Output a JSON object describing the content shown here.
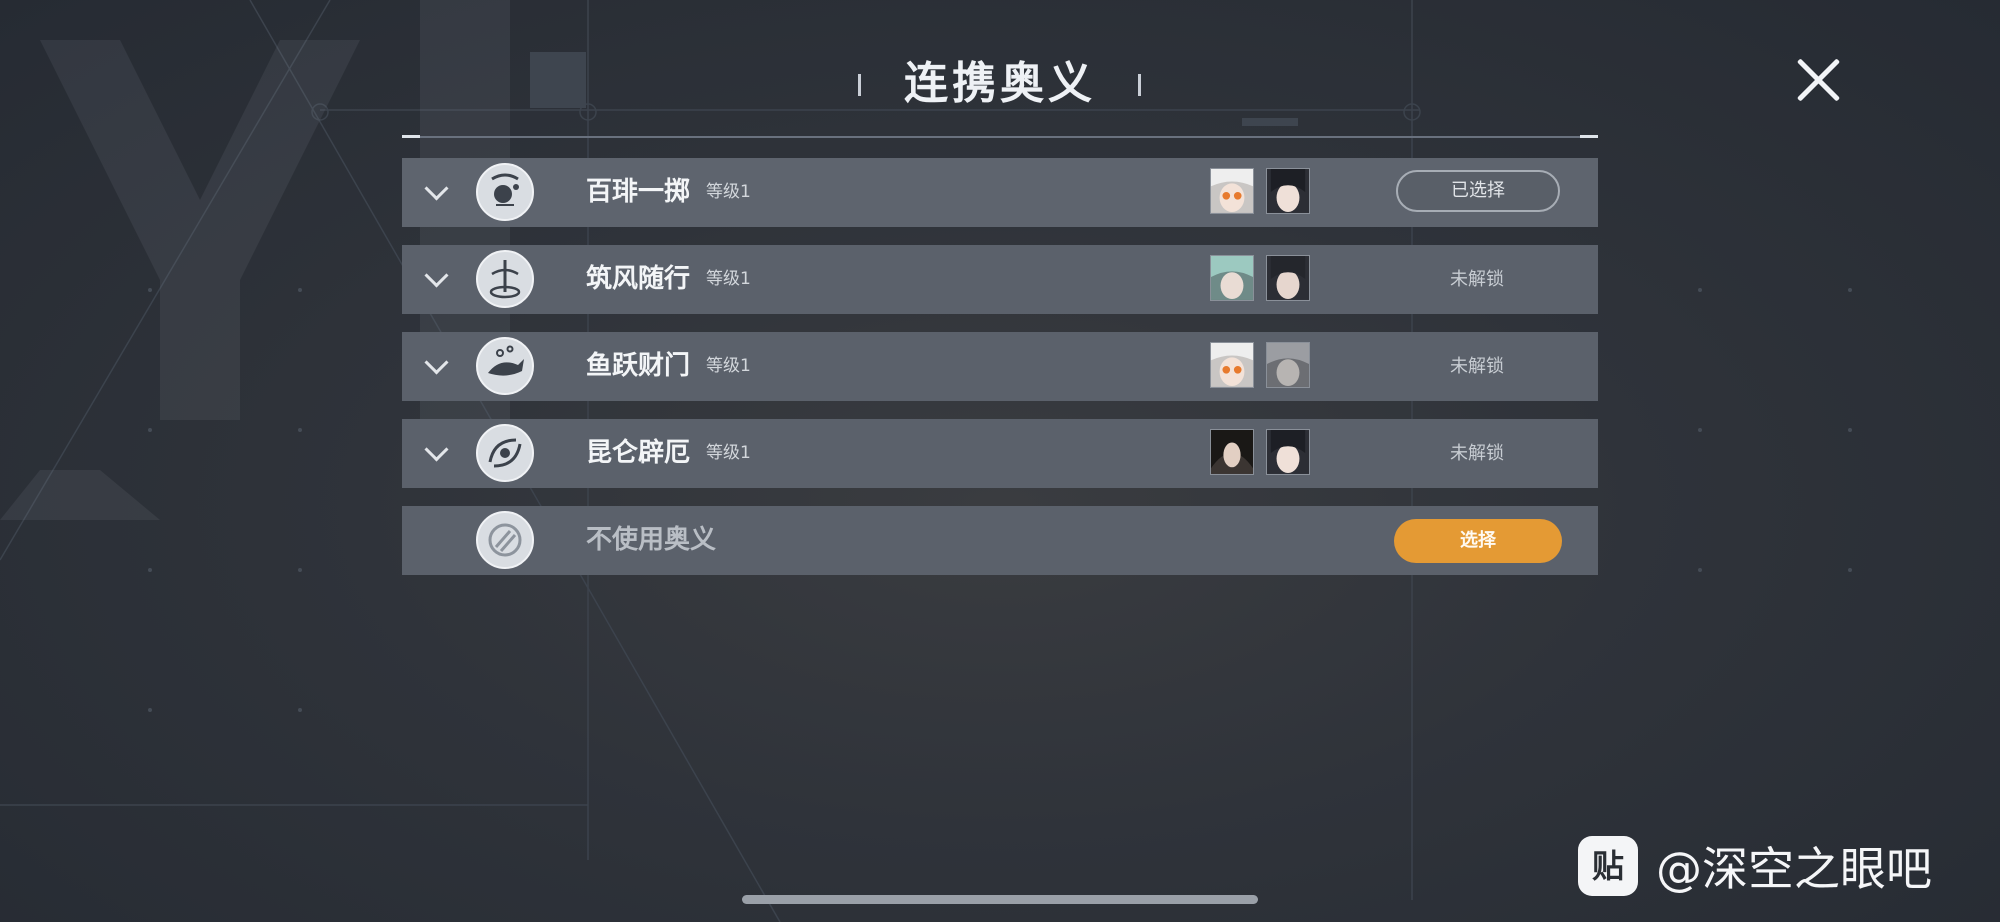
{
  "header": {
    "title": "连携奥义"
  },
  "rows": [
    {
      "name": "百琲一掷",
      "level": "等级1",
      "status": "已选择",
      "emblem": "sparkle-orb-emblem",
      "avatars": [
        "white-hair-glasses-avatar",
        "dark-hair-girl-avatar"
      ]
    },
    {
      "name": "筑风随行",
      "level": "等级1",
      "status": "未解锁",
      "emblem": "wind-vortex-emblem",
      "avatars": [
        "teal-hair-avatar",
        "dark-hair-girl-avatar"
      ]
    },
    {
      "name": "鱼跃财门",
      "level": "等级1",
      "status": "未解锁",
      "emblem": "leaping-fish-emblem",
      "avatars": [
        "white-hair-glasses-avatar",
        "grey-hair-avatar"
      ]
    },
    {
      "name": "昆仑辟厄",
      "level": "等级1",
      "status": "未解锁",
      "emblem": "swirl-guard-emblem",
      "avatars": [
        "dark-long-hair-avatar",
        "dark-hair-girl-avatar"
      ]
    }
  ],
  "no_skill": {
    "name": "不使用奥义",
    "button": "选择",
    "emblem": "slashed-circle-emblem"
  },
  "watermark": {
    "logo": "贴",
    "text": "@深空之眼吧"
  },
  "colors": {
    "accent": "#e49a34",
    "row_bg": "#5b616b",
    "background": "#2b3038"
  }
}
